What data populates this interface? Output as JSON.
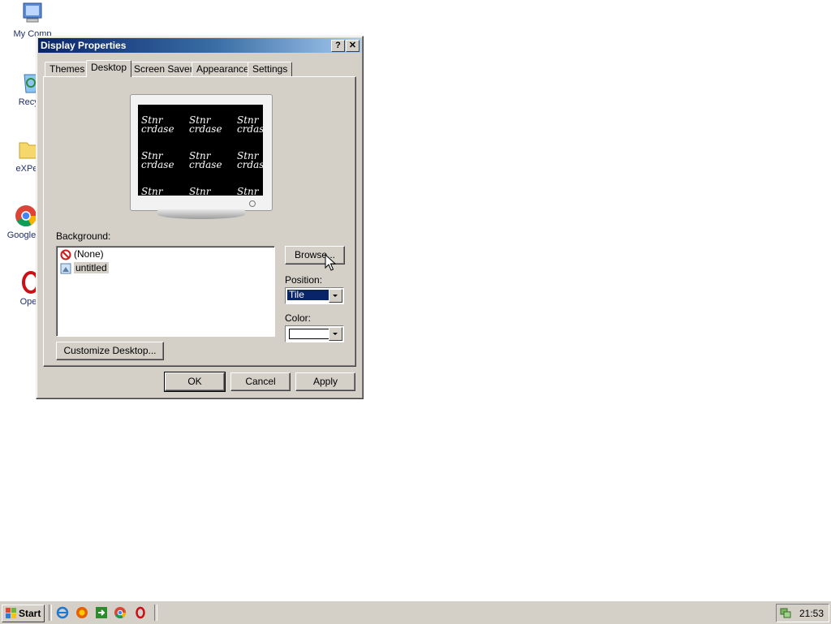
{
  "desktop": {
    "icons": [
      {
        "label": "My Comp",
        "icon": "computer-icon"
      },
      {
        "label": "Recyc",
        "icon": "recycle-bin-icon"
      },
      {
        "label": "eXPeri",
        "icon": "folder-icon"
      },
      {
        "label": "Google C",
        "icon": "chrome-icon"
      },
      {
        "label": "Ope",
        "icon": "opera-icon"
      }
    ]
  },
  "dialog": {
    "title": "Display Properties",
    "help_label": "?",
    "close_label": "✕",
    "tabs": [
      {
        "label": "Themes"
      },
      {
        "label": "Desktop",
        "active": true
      },
      {
        "label": "Screen Saver"
      },
      {
        "label": "Appearance"
      },
      {
        "label": "Settings"
      }
    ],
    "preview": {
      "tile_line1": "Stnr",
      "tile_line2": "crdase"
    },
    "background_label": "Background:",
    "background_list": [
      {
        "label": "(None)",
        "icon": "no-symbol-icon"
      },
      {
        "label": "untitled",
        "icon": "image-file-icon",
        "selected": true
      }
    ],
    "browse_button": "Browse...",
    "position_label": "Position:",
    "position_value": "Tile",
    "color_label": "Color:",
    "color_value": "#ffffff",
    "customize_button": "Customize Desktop...",
    "ok_button": "OK",
    "cancel_button": "Cancel",
    "apply_button": "Apply"
  },
  "taskbar": {
    "start_label": "Start",
    "quick_launch": [
      "ie-icon",
      "firefox-icon",
      "show-desktop-icon",
      "chrome-icon",
      "opera-icon"
    ],
    "clock": "21:53"
  },
  "colors": {
    "title_start": "#0a246a",
    "face": "#d4d0c8",
    "selection": "#0a246a"
  }
}
